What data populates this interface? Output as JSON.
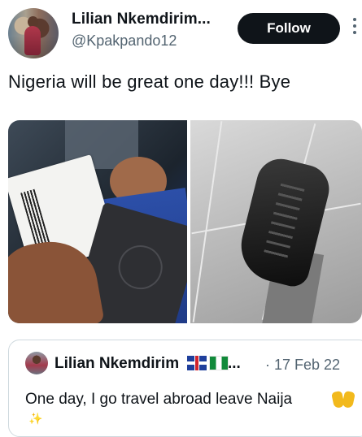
{
  "author": {
    "name": "Lilian Nkemdirim...",
    "handle": "@Kpakpando12",
    "follow_label": "Follow"
  },
  "tweet": {
    "text": "Nigeria will be great one day!!! Bye"
  },
  "media": [
    {
      "description_icon": "photo-icon"
    },
    {
      "description_icon": "photo-icon"
    }
  ],
  "quoted_tweet": {
    "name": "Lilian Nkemdirim",
    "ellipsis": "...",
    "separator_date": "· 17 Feb 22",
    "text": "One day, I go travel abroad leave Naija"
  },
  "icons": {
    "more": "more-vertical-icon",
    "uk_flag": "uk-flag-icon",
    "ng_flag": "nigeria-flag-icon",
    "hands": "raising-hands-icon"
  },
  "colors": {
    "text": "#0f1419",
    "secondary": "#536471",
    "follow_bg": "#0f1419",
    "border": "#cfd9de"
  }
}
